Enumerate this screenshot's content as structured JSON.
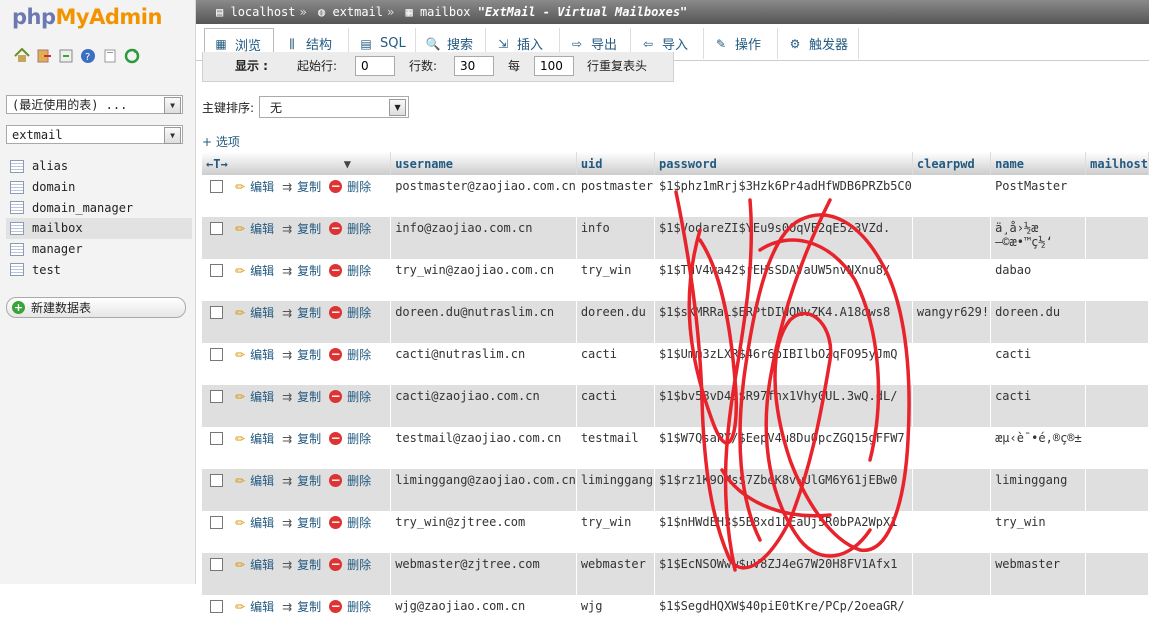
{
  "logo": {
    "part1": "php",
    "part2": "MyAdmin"
  },
  "sidebar": {
    "recent_select": "(最近使用的表) ...",
    "db_select": "extmail",
    "tables": [
      "alias",
      "domain",
      "domain_manager",
      "mailbox",
      "manager",
      "test"
    ],
    "active_table": "mailbox",
    "new_table_label": "新建数据表"
  },
  "breadcrumb": {
    "server": "localhost",
    "database": "extmail",
    "table": "mailbox",
    "comment": "\"ExtMail - Virtual Mailboxes\""
  },
  "tabs": [
    {
      "label": "浏览",
      "icon": "browse-icon",
      "active": true
    },
    {
      "label": "结构",
      "icon": "structure-icon"
    },
    {
      "label": "SQL",
      "icon": "sql-icon"
    },
    {
      "label": "搜索",
      "icon": "search-icon"
    },
    {
      "label": "插入",
      "icon": "insert-icon"
    },
    {
      "label": "导出",
      "icon": "export-icon"
    },
    {
      "label": "导入",
      "icon": "import-icon"
    },
    {
      "label": "操作",
      "icon": "operations-icon"
    },
    {
      "label": "触发器",
      "icon": "triggers-icon"
    }
  ],
  "display_bar": {
    "show_label": "显示 :",
    "start_label": "起始行:",
    "start_value": "0",
    "rows_label": "行数:",
    "rows_value": "30",
    "per_label": "每",
    "per_value": "100",
    "repeat_label": "行重复表头"
  },
  "sort": {
    "label": "主键排序:",
    "value": "无"
  },
  "options_link": "+ 选项",
  "actions": {
    "edit": "编辑",
    "copy": "复制",
    "delete": "删除"
  },
  "columns": [
    "username",
    "uid",
    "password",
    "clearpwd",
    "name",
    "mailhost"
  ],
  "rows": [
    {
      "username": "postmaster@zaojiao.com.cn",
      "uid": "postmaster",
      "password": "$1$phz1mRrj$3Hzk6Pr4adHfWDB6PRZb5C0",
      "clearpwd": "",
      "name": "PostMaster"
    },
    {
      "username": "info@zaojiao.com.cn",
      "uid": "info",
      "password": "$1$VodareZI$YEu9s0OqVE2qE5z3VZd.",
      "clearpwd": "",
      "name": "ä¸å›½æ\n—©æ•™ç½‘"
    },
    {
      "username": "try_win@zaojiao.com.cn",
      "uid": "try_win",
      "password": "$1$TuV4wa42$rEHsSDAVaUW5nvNXnu8/",
      "clearpwd": "",
      "name": "dabao"
    },
    {
      "username": "doreen.du@nutraslim.cn",
      "uid": "doreen.du",
      "password": "$1$sKMRRaL$ERPtDIWQNvZK4.A18ows8",
      "clearpwd": "wangyr629!",
      "name": "doreen.du"
    },
    {
      "username": "cacti@nutraslim.cn",
      "uid": "cacti",
      "password": "$1$Umm3zLXR$46r6bIBIlbOZqFO95yJmQ",
      "clearpwd": "",
      "name": "cacti"
    },
    {
      "username": "cacti@zaojiao.com.cn",
      "uid": "cacti",
      "password": "$1$bv58vD4S$R97fnx1Vhy0UL.3wQ.dL/",
      "clearpwd": "",
      "name": "cacti"
    },
    {
      "username": "testmail@zaojiao.com.cn",
      "uid": "testmail",
      "password": "$1$W7QsaPY/$EepV4u8Du0pcZGQ15gFFW7",
      "clearpwd": "",
      "name": "æµ‹è¯•é‚®ç®±"
    },
    {
      "username": "liminggang@zaojiao.com.cn",
      "uid": "liminggang",
      "password": "$1$rz1K9OMs$7ZbeK8vwUlGM6Y61jEBw0",
      "clearpwd": "",
      "name": "liminggang"
    },
    {
      "username": "try_win@zjtree.com",
      "uid": "try_win",
      "password": "$1$nHWdEH3$5B8xd1LEaUj5R0bPA2WpX1",
      "clearpwd": "",
      "name": "try_win"
    },
    {
      "username": "webmaster@zjtree.com",
      "uid": "webmaster",
      "password": "$1$EcNSOWww$uV8ZJ4eG7W20H8FV1Afx1",
      "clearpwd": "",
      "name": "webmaster"
    },
    {
      "username": "wjg@zaojiao.com.cn",
      "uid": "wjg",
      "password": "$1$SegdHQXW$40piE0tKre/PCp/2oeaGR/",
      "clearpwd": "",
      "name": ""
    }
  ]
}
